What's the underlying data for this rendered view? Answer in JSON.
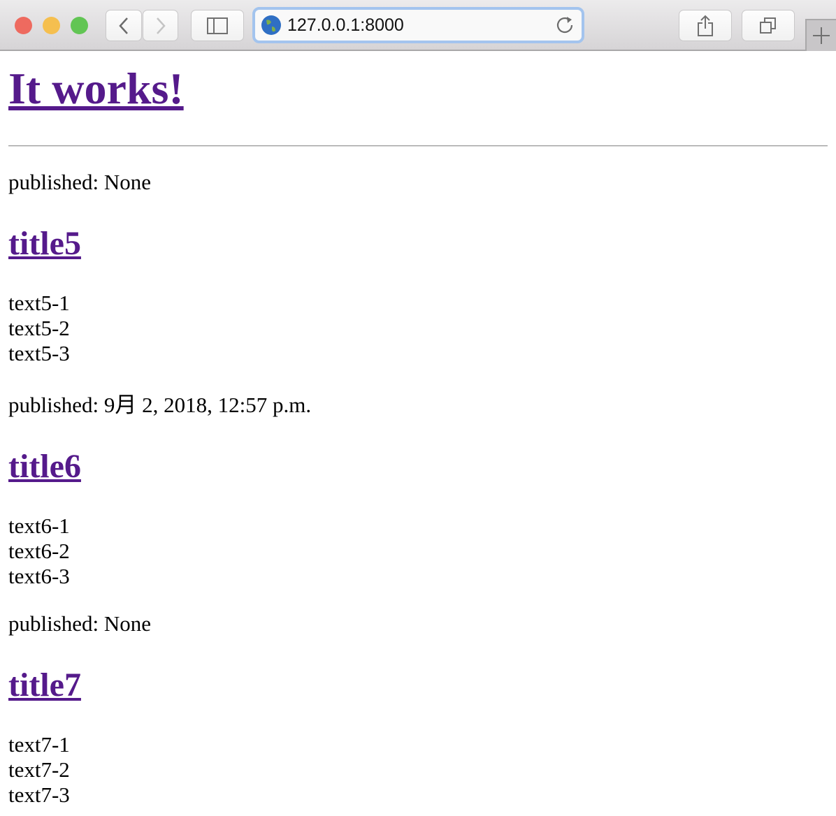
{
  "browser": {
    "url": "127.0.0.1:8000",
    "icons": [
      "close",
      "minimize",
      "zoom",
      "back-chevron",
      "forward-chevron",
      "sidebar",
      "globe",
      "reload",
      "share",
      "tabs-overview",
      "new-tab-plus"
    ]
  },
  "page": {
    "heading": "It works!",
    "posts": [
      {
        "published": "published: None",
        "title": "title5",
        "texts": [
          "text5-1",
          "text5-2",
          "text5-3"
        ]
      },
      {
        "published": "published: 9月 2, 2018, 12:57 p.m.",
        "title": "title6",
        "texts": [
          "text6-1",
          "text6-2",
          "text6-3"
        ]
      },
      {
        "published": "published: None",
        "title": "title7",
        "texts": [
          "text7-1",
          "text7-2",
          "text7-3"
        ]
      }
    ]
  },
  "colors": {
    "link_visited": "#551a8b",
    "focus_ring": "#a3c4ee"
  }
}
